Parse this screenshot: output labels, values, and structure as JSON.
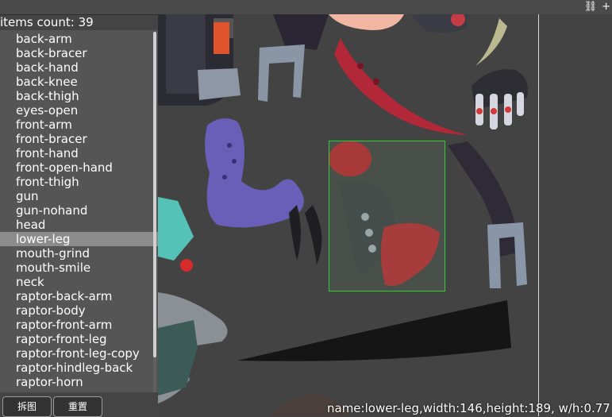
{
  "header": {
    "items_count_text": "items count: 39",
    "icons": [
      "link-icon",
      "plus-icon"
    ]
  },
  "list": {
    "selected_index": 14,
    "items": [
      "back-arm",
      "back-bracer",
      "back-hand",
      "back-knee",
      "back-thigh",
      "eyes-open",
      "front-arm",
      "front-bracer",
      "front-hand",
      "front-open-hand",
      "front-thigh",
      "gun",
      "gun-nohand",
      "head",
      "lower-leg",
      "mouth-grind",
      "mouth-smile",
      "neck",
      "raptor-back-arm",
      "raptor-body",
      "raptor-front-arm",
      "raptor-front-leg",
      "raptor-front-leg-copy",
      "raptor-hindleg-back",
      "raptor-horn"
    ]
  },
  "buttons": {
    "split_label": "拆图",
    "reset_label": "重置"
  },
  "selection": {
    "info_text": "name:lower-leg,width:146,height:189, w/h:0.77"
  },
  "colors": {
    "selection_border": "#2fd02f",
    "list_selected_bg": "#8c8c8c"
  }
}
